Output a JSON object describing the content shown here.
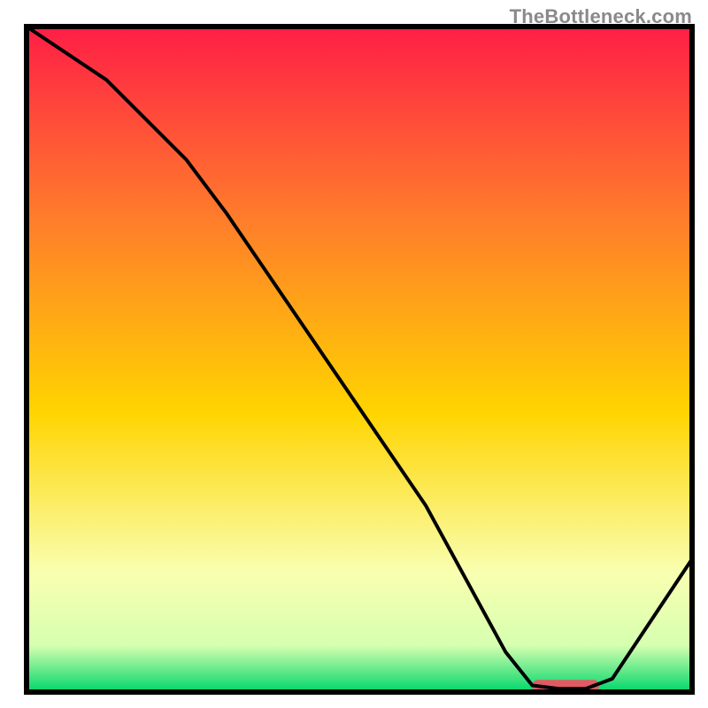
{
  "watermark": "TheBottleneck.com",
  "colors": {
    "curve": "#000000",
    "border": "#000000",
    "marker": "#e05a63",
    "grad_top": "#ff1e46",
    "grad_mid_hi": "#ff7a2c",
    "grad_mid": "#ffd400",
    "grad_lo": "#f9ffb0",
    "grad_green": "#00d66b"
  },
  "chart_data": {
    "type": "line",
    "title": "",
    "xlabel": "",
    "ylabel": "",
    "xlim": [
      0,
      100
    ],
    "ylim": [
      0,
      100
    ],
    "series": [
      {
        "name": "curve",
        "x": [
          0,
          12,
          24,
          30,
          45,
          60,
          72,
          76,
          80,
          84,
          88,
          100
        ],
        "y": [
          100,
          92,
          80,
          72,
          50,
          28,
          6,
          1,
          0.5,
          0.5,
          2,
          20
        ]
      }
    ],
    "optimal_zone": {
      "x_start": 76,
      "x_end": 86,
      "y": 0.9
    },
    "annotations": []
  }
}
